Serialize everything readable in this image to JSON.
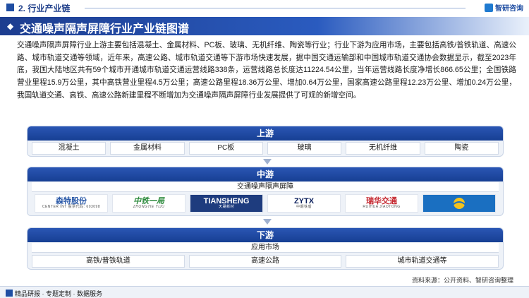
{
  "section": {
    "label": "2. 行业产业链"
  },
  "brand": {
    "name": "智研咨询"
  },
  "title": "交通噪声隔声屏障行业产业链图谱",
  "intro": "交通噪声隔声屏障行业上游主要包括混凝土、金属材料、PC板、玻璃、无机纤维、陶瓷等行业；行业下游为应用市场，主要包括高铁/普铁轨道、高速公路、城市轨道交通等领域，近年来，高速公路、城市轨道交通等下游市场快速发展，据中国交通运输部和中国城市轨道交通协会数据显示，截至2023年底，我国大陆地区共有59个城市开通城市轨道交通运营线路338条，运营线路总长度达11224.54公里，当年运营线路长度净增长866.65公里；全国铁路营业里程15.9万公里，其中高铁营业里程4.5万公里；高速公路里程18.36万公里、增加0.64万公里，国家高速公路里程12.23万公里、增加0.24万公里，我国轨道交通、高铁、高速公路新建里程不断增加为交通噪声隔声屏障行业发展提供了可观的新增空间。",
  "upstream": {
    "label": "上游",
    "items": [
      "混凝土",
      "金属材料",
      "PC板",
      "玻璃",
      "无机纤维",
      "陶瓷"
    ]
  },
  "midstream": {
    "label": "中游",
    "sub": "交通噪声隔声屏障",
    "logos": [
      {
        "main": "森特股份",
        "sub": "CENTER INT  股票代码: 603098"
      },
      {
        "main": "中铁一局",
        "sub": "ZHONGTIE YIJU"
      },
      {
        "main": "TIANSHENG",
        "sub": "天晟新材"
      },
      {
        "main": "ZYTX",
        "sub": "中期铁盾"
      },
      {
        "main": "瑞华交通",
        "sub": "RUIHUA JIAOTONG"
      },
      {
        "main": "",
        "sub": ""
      }
    ]
  },
  "downstream": {
    "label": "下游",
    "sub": "应用市场",
    "items": [
      "高铁/普铁轨道",
      "高速公路",
      "城市轨道交通等"
    ]
  },
  "source": "资料来源：公开资料、智研咨询整理",
  "footer": "精品研报 · 专题定制 · 数据服务"
}
